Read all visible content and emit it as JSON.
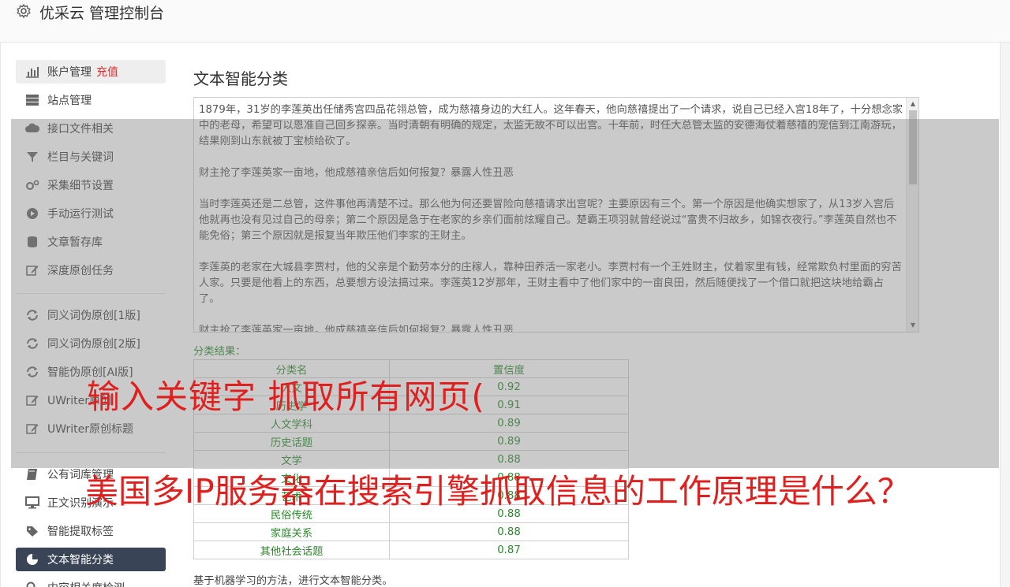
{
  "header": {
    "title": "优采云 管理控制台",
    "icon": "gear-icon"
  },
  "sidebar": {
    "recharge_label": "充值",
    "items": [
      {
        "label": "账户管理",
        "icon": "bar-chart-icon"
      },
      {
        "label": "站点管理",
        "icon": "server-icon"
      },
      {
        "label": "接口文件相关",
        "icon": "cloud-upload-icon"
      },
      {
        "label": "栏目与关键词",
        "icon": "filter-icon"
      },
      {
        "label": "采集细节设置",
        "icon": "cogs-icon"
      },
      {
        "label": "手动运行测试",
        "icon": "play-icon"
      },
      {
        "label": "文章暂存库",
        "icon": "database-icon"
      },
      {
        "label": "深度原创任务",
        "icon": "edit-icon"
      },
      {
        "label": "同义词伪原创[1版]",
        "icon": "refresh-icon"
      },
      {
        "label": "同义词伪原创[2版]",
        "icon": "refresh-icon"
      },
      {
        "label": "智能伪原创[AI版]",
        "icon": "refresh-icon"
      },
      {
        "label": "UWriter原创",
        "icon": "edit-icon"
      },
      {
        "label": "UWriter原创标题",
        "icon": "edit-icon"
      },
      {
        "label": "公有词库管理",
        "icon": "book-icon"
      },
      {
        "label": "正文识别演示",
        "icon": "monitor-icon"
      },
      {
        "label": "智能提取标签",
        "icon": "tag-icon"
      },
      {
        "label": "文本智能分类",
        "icon": "pie-chart-icon"
      },
      {
        "label": "内容相关度检测",
        "icon": "search-icon"
      }
    ]
  },
  "main": {
    "title": "文本智能分类",
    "paragraphs": [
      "1879年，31岁的李莲英出任储秀宫四品花翎总管，成为慈禧身边的大红人。这年春天，他向慈禧提出了一个请求，说自己已经入宫18年了，十分想念家中的老母，希望可以恩准自己回乡探亲。当时清朝有明确的规定，太监无故不可以出宫。十年前，时任大总管太监的安德海仗着慈禧的宠信到江南游玩，结果刚到山东就被丁宝桢给砍了。",
      "财主抢了李莲英家一亩地，他成慈禧亲信后如何报复？暴露人性丑恶",
      "当时李莲英还是二总管，这件事他再清楚不过。那么他为何还要冒险向慈禧请求出宫呢？主要原因有三个。第一个原因是他确实想家了，从13岁入宫后他就再也没有见过自己的母亲；第二个原因是急于在老家的乡亲们面前炫耀自己。楚霸王项羽就曾经说过“富贵不归故乡，如锦衣夜行。”李莲英自然也不能免俗；第三个原因就是报复当年欺压他们李家的王财主。",
      "李莲英的老家在大城县李贾村，他的父亲是个勤劳本分的庄稼人，靠种田养活一家老小。李贾村有一个王姓财主，仗着家里有钱，经常欺负村里面的穷苦人家。只要是他看上的东西，总要想方设法搞过来。李莲英12岁那年，王财主看中了他们家中的一亩良田，然后随便找了一个借口就把这块地给霸占了。",
      "财主抢了李莲英家一亩地，他成慈禧亲信后如何报复？暴露人性丑恶"
    ],
    "result_label": "分类结果：",
    "table_headers": [
      "分类名",
      "置信度"
    ],
    "rows": [
      {
        "name": "人文",
        "score": "0.92"
      },
      {
        "name": "历史学",
        "score": "0.91"
      },
      {
        "name": "人文学科",
        "score": "0.89"
      },
      {
        "name": "历史话题",
        "score": "0.89"
      },
      {
        "name": "文学",
        "score": "0.88"
      },
      {
        "name": "文化",
        "score": "0.88"
      },
      {
        "name": "艺术",
        "score": "0.88"
      },
      {
        "name": "民俗传统",
        "score": "0.88"
      },
      {
        "name": "家庭关系",
        "score": "0.88"
      },
      {
        "name": "其他社会话题",
        "score": "0.87"
      }
    ],
    "footnote": "基于机器学习的方法，进行文本智能分类。"
  },
  "overlay": {
    "caption1": "输入关键字 抓取所有网页(",
    "caption2": "美国多IP服务器在搜索引擎抓取信息的工作原理是什么？"
  }
}
